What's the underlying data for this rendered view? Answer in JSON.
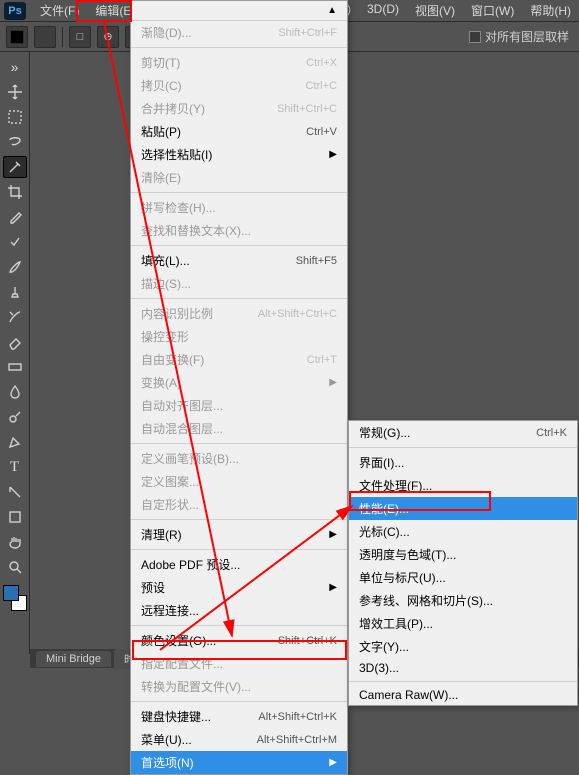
{
  "menubar": {
    "logo": "Ps",
    "items_left": [
      "文件(F)",
      "编辑(E)"
    ],
    "items_right": [
      "t(T)",
      "3D(D)",
      "视图(V)",
      "窗口(W)",
      "帮助(H)"
    ]
  },
  "toolbar": {
    "sample_label": "对所有图层取样"
  },
  "edit_menu": {
    "groups": [
      [
        {
          "label": "渐隐(D)...",
          "shortcut": "Shift+Ctrl+F",
          "disabled": true
        }
      ],
      [
        {
          "label": "剪切(T)",
          "shortcut": "Ctrl+X",
          "disabled": true
        },
        {
          "label": "拷贝(C)",
          "shortcut": "Ctrl+C",
          "disabled": true
        },
        {
          "label": "合并拷贝(Y)",
          "shortcut": "Shift+Ctrl+C",
          "disabled": true
        },
        {
          "label": "粘贴(P)",
          "shortcut": "Ctrl+V",
          "disabled": false
        },
        {
          "label": "选择性粘贴(I)",
          "submenu": true,
          "disabled": false
        },
        {
          "label": "清除(E)",
          "disabled": true
        }
      ],
      [
        {
          "label": "拼写检查(H)...",
          "disabled": true
        },
        {
          "label": "查找和替换文本(X)...",
          "disabled": true
        }
      ],
      [
        {
          "label": "填充(L)...",
          "shortcut": "Shift+F5",
          "disabled": false
        },
        {
          "label": "描边(S)...",
          "disabled": true
        }
      ],
      [
        {
          "label": "内容识别比例",
          "shortcut": "Alt+Shift+Ctrl+C",
          "disabled": true
        },
        {
          "label": "操控变形",
          "disabled": true
        },
        {
          "label": "自由变换(F)",
          "shortcut": "Ctrl+T",
          "disabled": true
        },
        {
          "label": "变换(A)",
          "submenu": true,
          "disabled": true
        },
        {
          "label": "自动对齐图层...",
          "disabled": true
        },
        {
          "label": "自动混合图层...",
          "disabled": true
        }
      ],
      [
        {
          "label": "定义画笔预设(B)...",
          "disabled": true
        },
        {
          "label": "定义图案...",
          "disabled": true
        },
        {
          "label": "自定形状...",
          "disabled": true
        }
      ],
      [
        {
          "label": "清理(R)",
          "submenu": true,
          "disabled": false
        }
      ],
      [
        {
          "label": "Adobe PDF 预设...",
          "disabled": false
        },
        {
          "label": "预设",
          "submenu": true,
          "disabled": false
        },
        {
          "label": "远程连接...",
          "disabled": false
        }
      ],
      [
        {
          "label": "颜色设置(G)...",
          "shortcut": "Shift+Ctrl+K",
          "disabled": false
        },
        {
          "label": "指定配置文件...",
          "disabled": true
        },
        {
          "label": "转换为配置文件(V)...",
          "disabled": true
        }
      ],
      [
        {
          "label": "键盘快捷键...",
          "shortcut": "Alt+Shift+Ctrl+K",
          "disabled": false
        },
        {
          "label": "菜单(U)...",
          "shortcut": "Alt+Shift+Ctrl+M",
          "disabled": false
        },
        {
          "label": "首选项(N)",
          "submenu": true,
          "highlight": true,
          "disabled": false
        }
      ]
    ]
  },
  "pref_menu": {
    "groups": [
      [
        {
          "label": "常规(G)...",
          "shortcut": "Ctrl+K"
        }
      ],
      [
        {
          "label": "界面(I)..."
        },
        {
          "label": "文件处理(F)..."
        },
        {
          "label": "性能(E)...",
          "highlight": true
        },
        {
          "label": "光标(C)..."
        },
        {
          "label": "透明度与色域(T)..."
        },
        {
          "label": "单位与标尺(U)..."
        },
        {
          "label": "参考线、网格和切片(S)..."
        },
        {
          "label": "增效工具(P)..."
        },
        {
          "label": "文字(Y)..."
        },
        {
          "label": "3D(3)..."
        }
      ],
      [
        {
          "label": "Camera Raw(W)..."
        }
      ]
    ]
  },
  "bottom_tabs": [
    "Mini Bridge",
    "时间轴"
  ]
}
